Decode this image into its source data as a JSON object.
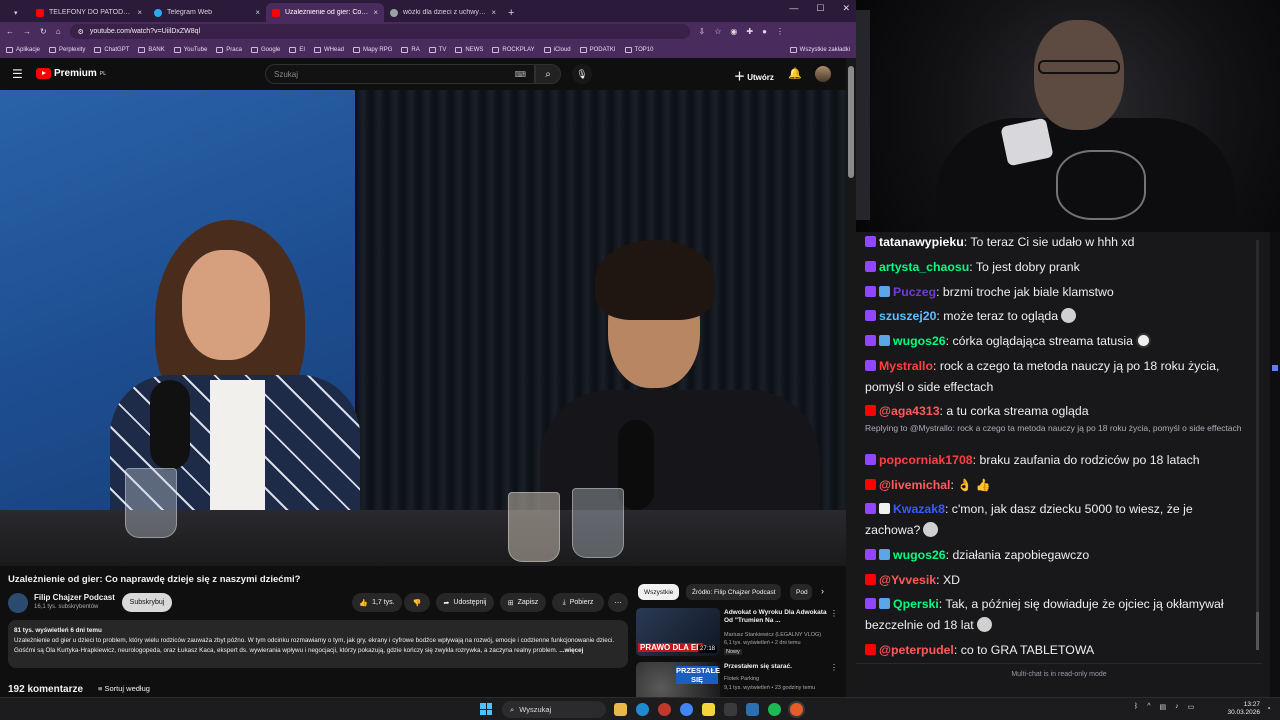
{
  "browser": {
    "tabs": [
      {
        "label": "TELEFONY DO PATODEWELOPERA",
        "color": "#ff0000",
        "active": false
      },
      {
        "label": "Telegram Web",
        "color": "#2aabee",
        "active": false
      },
      {
        "label": "Uzależnienie od gier: Co naprawdę dzieje się z naszymi dziećmi?",
        "color": "#ff0000",
        "active": true
      },
      {
        "label": "wózki dla dzieci z uchwytem na kubek",
        "color": "#9aa0a6",
        "active": false
      }
    ],
    "url": "youtube.com/watch?v=UiilDxZW8ql",
    "bookmarks": [
      "Aplikacje",
      "Perplexity",
      "ChatGPT",
      "BANK",
      "YouTube",
      "Praca",
      "Google",
      "EI",
      "WHead",
      "Mapy RPG",
      "RA",
      "TV",
      "NEWS",
      "ROCKPLAY",
      "iCloud",
      "PODATKI",
      "TOP10"
    ],
    "bookmarks_all": "Wszystkie zakładki"
  },
  "youtube": {
    "logo": "Premium",
    "logo_sup": "PL",
    "search_placeholder": "Szukaj",
    "create_label": "Utwórz",
    "video_title": "Uzależnienie od gier: Co naprawdę dzieje się z naszymi dziećmi?",
    "channel_name": "Filip Chajzer Podcast",
    "subscribers": "16,1 tys. subskrybentów",
    "subscribe_label": "Subskrybuj",
    "likes": "1,7 tys.",
    "share_label": "Udostępnij",
    "save_label": "Zapisz",
    "download_label": "Pobierz",
    "desc_meta": "81 tys. wyświetleń  6 dni temu",
    "desc_text": "Uzależnienie od gier u dzieci to problem, który wielu rodziców zauważa zbyt późno. W tym odcinku rozmawiamy o tym, jak gry, ekrany i cyfrowe bodźce wpływają na rozwój, emocje i codzienne funkcjonowanie dzieci. Gośćmi są Ola Kurtyka-Hrapkiewicz, neurologopeda, oraz Łukasz Kaca, ekspert ds. wywierania wpływu i negocjacji, którzy pokazują, gdzie kończy się zwykła rozrywka, a zaczyna realny problem.",
    "desc_more": "...więcej",
    "comments_count": "192 komentarze",
    "sort_label": "Sortuj według",
    "chips": [
      "Wszystkie",
      "Źródło: Filip Chajzer Podcast",
      "Pod"
    ],
    "suggestions": [
      {
        "title": "Adwokat o Wyroku Dla Adwokata Od \"Trumien Na ...",
        "channel": "Mariusz Stankiewicz (LEGALNY VLOG)",
        "stats": "6,1 tys. wyświetleń • 2 dni temu",
        "badge": "Nowy",
        "thumb_text": "PRAWO DLA EL",
        "duration": "27:18"
      },
      {
        "title": "Przestałem się starać.",
        "channel": "Flotek Parking",
        "stats": "9,1 tys. wyświetleń • 23 godziny temu",
        "badge": "",
        "thumb_text": "PRZESTAŁEM SIĘ",
        "duration": ""
      }
    ]
  },
  "chat": {
    "messages": [
      {
        "platform": "tw",
        "user": "tatanawypieku",
        "color": "#ffffff",
        "text": "To teraz Ci sie udało w hhh xd",
        "emote": false
      },
      {
        "platform": "tw",
        "user": "artysta_chaosu",
        "color": "#00ff7f",
        "text": "To jest dobry prank",
        "emote": false
      },
      {
        "platform": "tw",
        "user": "Puczeg",
        "color": "#6f3bd6",
        "text": "brzmi troche jak biale klamstwo",
        "emote": false
      },
      {
        "platform": "tw",
        "user": "szuszej20",
        "color": "#5bc0ff",
        "text": "może teraz to ogląda",
        "emote": true
      },
      {
        "platform": "tw",
        "user": "wugos26",
        "color": "#00ff7f",
        "text": "córka oglądająca streama tatusia",
        "emote": true
      },
      {
        "platform": "tw",
        "user": "Mystrallo",
        "color": "#ff4040",
        "text": "rock a czego ta metoda nauczy ją po 18 roku życia, pomyśl o side effectach",
        "emote": false
      },
      {
        "platform": "yt",
        "user": "@aga4313",
        "color": "#ff5a5a",
        "text": "a tu corka streama ogląda",
        "emote": false
      },
      {
        "platform": "tw",
        "user": "popcorniak1708",
        "color": "#ff4040",
        "text": "braku zaufania do rodziców po 18 latach",
        "emote": false
      },
      {
        "platform": "yt",
        "user": "@livemichal",
        "color": "#ff5a5a",
        "text": "👌 👍",
        "emote": false
      },
      {
        "platform": "tw",
        "user": "Kwazak8",
        "color": "#3a5bff",
        "text": "c'mon, jak dasz dziecku 5000 to wiesz, że je zachowa?",
        "emote": true
      },
      {
        "platform": "tw",
        "user": "wugos26",
        "color": "#00ff7f",
        "text": "działania zapobiegawczo",
        "emote": false
      },
      {
        "platform": "yt",
        "user": "@Yvvesik",
        "color": "#ff5a5a",
        "text": "XD",
        "emote": false
      },
      {
        "platform": "tw",
        "user": "Qperski",
        "color": "#00ff7f",
        "text": "Tak, a później się dowiaduje że ojciec ją okłamywał bezczelnie od 18 lat",
        "emote": true
      },
      {
        "platform": "yt",
        "user": "@peterpudel",
        "color": "#ff5a5a",
        "text": "co to GRA TABLETOWA",
        "emote": false
      }
    ],
    "reply_note": "Replying to @Mystrallo: rock a czego ta metoda nauczy ją po 18 roku życia, pomyśl o side effectach",
    "footer": "Multi-chat is in read-only mode"
  },
  "taskbar": {
    "search_label": "Wyszukaj",
    "time": "13:27",
    "date": "30.03.2026"
  },
  "colors": {
    "youtube_red": "#ff0000",
    "twitch_purple": "#9146ff",
    "browser_tab_bg": "#2b1a3a",
    "browser_toolbar_bg": "#4a2b5e"
  }
}
